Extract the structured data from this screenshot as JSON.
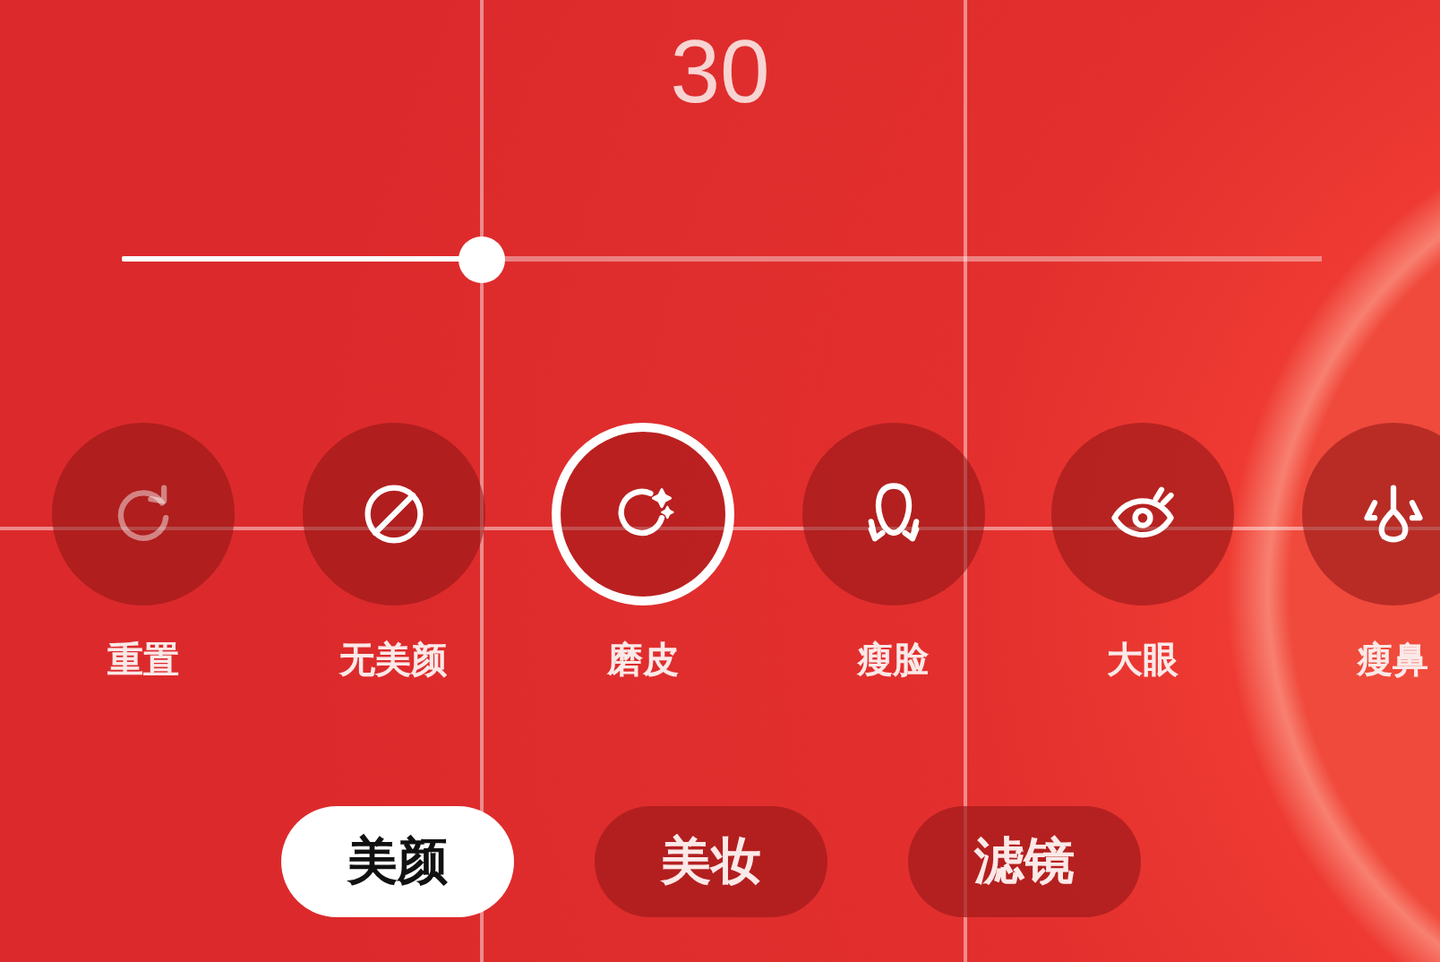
{
  "value": "30",
  "slider": {
    "level": 0.3
  },
  "effects": [
    {
      "kind": "reset",
      "label": "重置",
      "selected": false,
      "disabled": true
    },
    {
      "kind": "none",
      "label": "无美颜",
      "selected": false,
      "disabled": false
    },
    {
      "kind": "smooth",
      "label": "磨皮",
      "selected": true,
      "disabled": false
    },
    {
      "kind": "slim-face",
      "label": "瘦脸",
      "selected": false,
      "disabled": false
    },
    {
      "kind": "big-eye",
      "label": "大眼",
      "selected": false,
      "disabled": false
    },
    {
      "kind": "slim-nose",
      "label": "瘦鼻",
      "selected": false,
      "disabled": false
    }
  ],
  "tabs": [
    {
      "label": "美颜",
      "selected": true
    },
    {
      "label": "美妆",
      "selected": false
    },
    {
      "label": "滤镜",
      "selected": false
    }
  ]
}
